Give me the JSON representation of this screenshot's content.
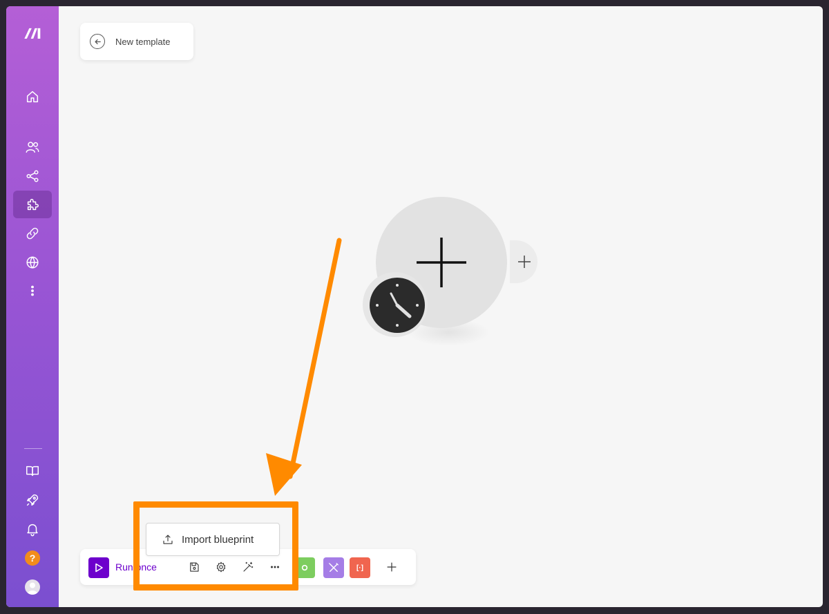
{
  "header": {
    "title": "New template"
  },
  "sidebar": {
    "items": [
      {
        "icon": "home-icon"
      },
      {
        "icon": "team-icon"
      },
      {
        "icon": "share-icon"
      },
      {
        "icon": "puzzle-icon",
        "active": true
      },
      {
        "icon": "link-icon"
      },
      {
        "icon": "globe-icon"
      },
      {
        "icon": "more-vertical-icon"
      }
    ],
    "bottom_items": [
      {
        "icon": "book-icon"
      },
      {
        "icon": "rocket-icon"
      },
      {
        "icon": "bell-icon"
      },
      {
        "icon": "help-icon",
        "label": "?"
      },
      {
        "icon": "avatar-icon"
      }
    ]
  },
  "toolbar": {
    "run_label": "Run once",
    "icons": [
      "save-icon",
      "settings-icon",
      "magic-wand-icon",
      "more-horizontal-icon"
    ],
    "tools": [
      {
        "icon": "gear-tool-icon",
        "color": "#7dcd5f"
      },
      {
        "icon": "tools-icon",
        "color": "#a57de6"
      },
      {
        "icon": "brackets-icon",
        "label": "[·]",
        "color": "#f0654f"
      }
    ]
  },
  "popup": {
    "import_label": "Import blueprint"
  },
  "colors": {
    "accent": "#6d00cc",
    "highlight": "#ff8a00"
  }
}
